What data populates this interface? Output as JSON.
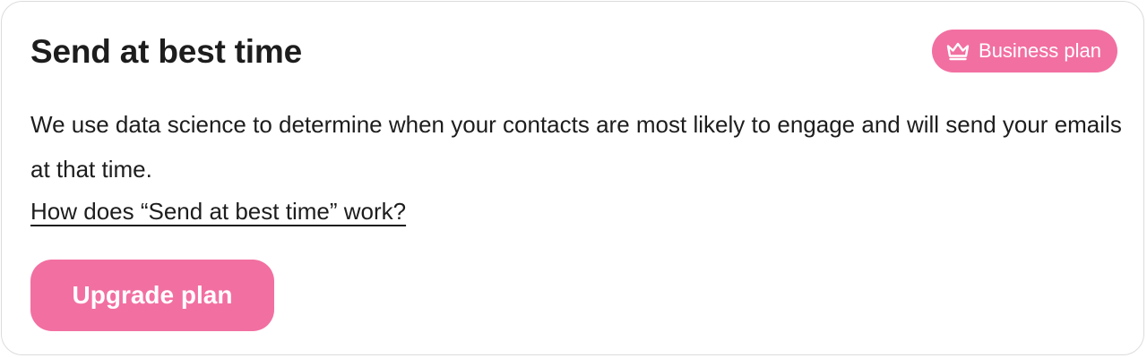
{
  "card": {
    "title": "Send at best time",
    "badge": {
      "icon": "crown-icon",
      "label": "Business plan"
    },
    "description": "We use data science to determine when your contacts are most likely to engage and will send your emails at that time.",
    "help_link": "How does “Send at best time” work?",
    "upgrade_button": "Upgrade plan"
  },
  "colors": {
    "accent": "#f26fa1",
    "text": "#1d1d1d",
    "border": "#dcdcdc",
    "background": "#ffffff"
  }
}
